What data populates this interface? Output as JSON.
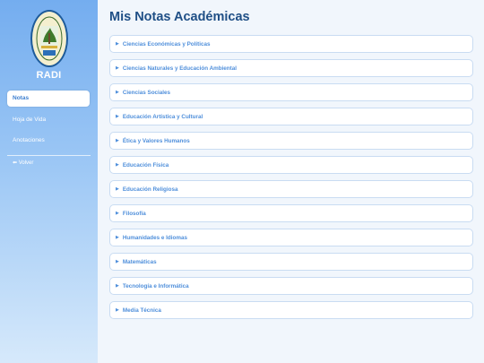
{
  "sidebar": {
    "brand": "RADI",
    "items": [
      {
        "label": "Notas"
      },
      {
        "label": "Hoja de Vida"
      },
      {
        "label": "Anotaciones"
      }
    ],
    "back_label": "⬅ Volver"
  },
  "main": {
    "title": "Mis Notas Académicas",
    "subjects": [
      {
        "label": "Ciencias Económicas y Políticas"
      },
      {
        "label": "Ciencias Naturales y Educación Ambiental"
      },
      {
        "label": "Ciencias Sociales"
      },
      {
        "label": "Educación Artística y Cultural"
      },
      {
        "label": "Ética y Valores Humanos"
      },
      {
        "label": "Educación Física"
      },
      {
        "label": "Educación Religiosa"
      },
      {
        "label": "Filosofía"
      },
      {
        "label": "Humanidades e Idiomas"
      },
      {
        "label": "Matemáticas"
      },
      {
        "label": "Tecnología e Informática"
      },
      {
        "label": "Media Técnica"
      }
    ]
  },
  "colors": {
    "sidebar_top": "#74adef",
    "sidebar_bottom": "#d6e9fb",
    "title": "#1f4f86",
    "subject_text": "#4f8fdb",
    "page_bg": "#f1f6fc"
  },
  "icons": {
    "logo": "school-crest-logo",
    "subject_arrow": "triangle-right-icon"
  }
}
